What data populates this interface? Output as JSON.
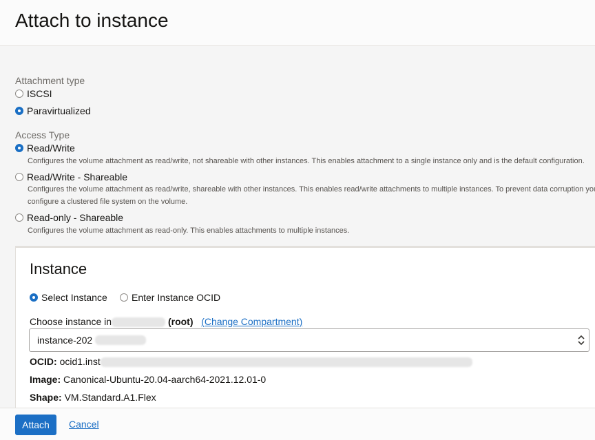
{
  "header": {
    "title": "Attach to instance"
  },
  "attachment_type": {
    "label": "Attachment type",
    "options": [
      {
        "label": "ISCSI",
        "selected": false
      },
      {
        "label": "Paravirtualized",
        "selected": true
      }
    ]
  },
  "access_type": {
    "label": "Access Type",
    "options": [
      {
        "label": "Read/Write",
        "selected": true,
        "description": "Configures the volume attachment as read/write, not shareable with other instances. This enables attachment to a single instance only and is the default configuration."
      },
      {
        "label": "Read/Write - Shareable",
        "selected": false,
        "description_line1": "Configures the volume attachment as read/write, shareable with other instances. This enables read/write attachments to multiple instances. To prevent data corruption you m",
        "description_line2": "configure a clustered file system on the volume."
      },
      {
        "label": "Read-only - Shareable",
        "selected": false,
        "description": "Configures the volume attachment as read-only. This enables attachments to multiple instances."
      }
    ]
  },
  "instance": {
    "title": "Instance",
    "mode_options": [
      {
        "label": "Select Instance",
        "selected": true
      },
      {
        "label": "Enter Instance OCID",
        "selected": false
      }
    ],
    "choose_label": "Choose instance in",
    "compartment_suffix": "(root)",
    "change_compartment": "(Change Compartment)",
    "selected_value": "instance-202",
    "ocid_label": "OCID:",
    "ocid_value": "ocid1.inst",
    "image_label": "Image:",
    "image_value": "Canonical-Ubuntu-20.04-aarch64-2021.12.01-0",
    "shape_label": "Shape:",
    "shape_value": "VM.Standard.A1.Flex"
  },
  "footer": {
    "attach_label": "Attach",
    "cancel_label": "Cancel"
  },
  "colors": {
    "accent": "#1c6fc5",
    "background": "#f5f5f5",
    "panel": "#ffffff"
  }
}
